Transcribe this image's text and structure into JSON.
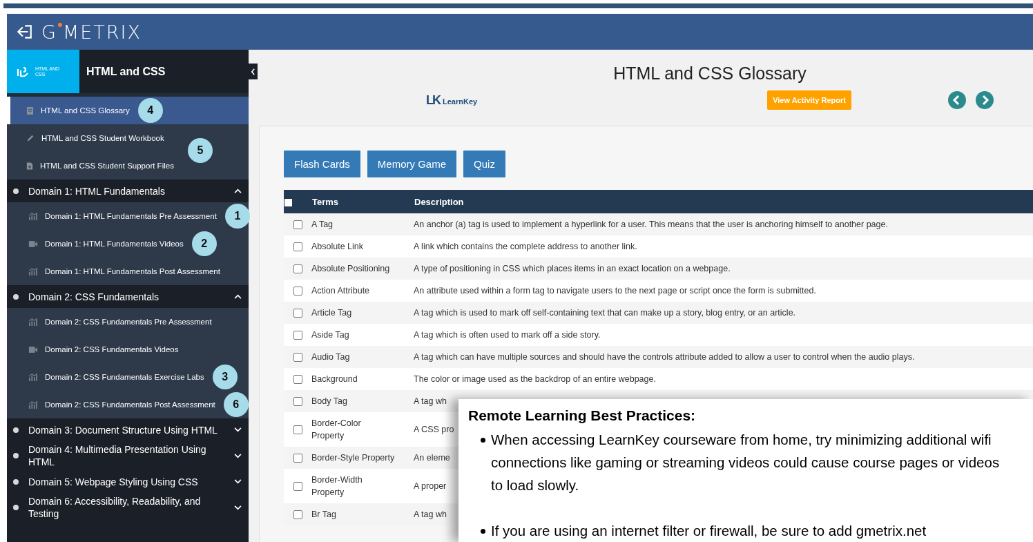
{
  "header": {
    "brand_parts": [
      "G",
      "METRIX"
    ]
  },
  "sidebar": {
    "course": {
      "badge_text": "HTML AND CSS",
      "title": "HTML and CSS"
    },
    "resources": [
      {
        "label": "HTML and CSS Glossary",
        "kind": "book",
        "selected": true,
        "marker": "4"
      },
      {
        "label": "HTML and CSS Student Workbook",
        "kind": "pencil",
        "selected": false,
        "marker": "5"
      },
      {
        "label": "HTML and CSS Student Support Files",
        "kind": "file",
        "selected": false
      }
    ],
    "domains": [
      {
        "label": "Domain 1: HTML Fundamentals",
        "expanded": true,
        "children": [
          {
            "label": "Domain 1: HTML Fundamentals Pre Assessment",
            "kind": "chart",
            "marker": "1"
          },
          {
            "label": "Domain 1: HTML Fundamentals Videos",
            "kind": "video",
            "marker": "2"
          },
          {
            "label": "Domain 1: HTML Fundamentals Post Assessment",
            "kind": "chart"
          }
        ]
      },
      {
        "label": "Domain 2: CSS Fundamentals",
        "expanded": true,
        "children": [
          {
            "label": "Domain 2: CSS Fundamentals Pre Assessment",
            "kind": "chart"
          },
          {
            "label": "Domain 2: CSS Fundamentals Videos",
            "kind": "video"
          },
          {
            "label": "Domain 2: CSS Fundamentals Exercise Labs",
            "kind": "chart",
            "marker": "3"
          },
          {
            "label": "Domain 2: CSS Fundamentals Post Assessment",
            "kind": "chart",
            "marker": "6"
          }
        ]
      },
      {
        "label": "Domain 3: Document Structure Using HTML",
        "expanded": false
      },
      {
        "label": "Domain 4: Multimedia Presentation Using HTML",
        "expanded": false
      },
      {
        "label": "Domain 5: Webpage Styling Using CSS",
        "expanded": false
      },
      {
        "label": "Domain 6: Accessibility, Readability, and Testing",
        "expanded": false
      }
    ]
  },
  "main": {
    "title": "HTML and CSS Glossary",
    "logo_mark": "LK",
    "logo_text": "LearnKey",
    "report_button": "View Activity Report",
    "activity_buttons": [
      "Flash Cards",
      "Memory Game",
      "Quiz"
    ],
    "table": {
      "columns": [
        "Terms",
        "Description"
      ],
      "select_all_checked": false,
      "rows": [
        {
          "term": "A Tag",
          "description": "An anchor (a) tag is used to implement a hyperlink for a user. This means that the user is anchoring himself to another page.",
          "checked": false
        },
        {
          "term": "Absolute Link",
          "description": "A link which contains the complete address to another link.",
          "checked": false
        },
        {
          "term": "Absolute Positioning",
          "description": "A type of positioning in CSS which places items in an exact location on a webpage.",
          "checked": false
        },
        {
          "term": "Action Attribute",
          "description": "An attribute used within a form tag to navigate users to the next page or script once the form is submitted.",
          "checked": false
        },
        {
          "term": "Article Tag",
          "description": "A tag which is used to mark off self-containing text that can make up a story, blog entry, or an article.",
          "checked": false
        },
        {
          "term": "Aside Tag",
          "description": "A tag which is often used to mark off a side story.",
          "checked": false
        },
        {
          "term": "Audio Tag",
          "description": "A tag which can have multiple sources and should have the controls attribute added to allow a user to control when the audio plays.",
          "checked": false
        },
        {
          "term": "Background",
          "description": "The color or image used as the backdrop of an entire webpage.",
          "checked": false
        },
        {
          "term": "Body Tag",
          "description": "A tag wh",
          "checked": false
        },
        {
          "term": "Border-Color Property",
          "description": "A CSS pro",
          "checked": false
        },
        {
          "term": "Border-Style Property",
          "description": "An eleme",
          "checked": false
        },
        {
          "term": "Border-Width Property",
          "description": "A proper",
          "checked": false
        },
        {
          "term": "Br Tag",
          "description": "A tag wh",
          "checked": false
        }
      ]
    }
  },
  "callout": {
    "title": "Remote Learning Best Practices:",
    "bullets": [
      "When accessing LearnKey courseware from home, try minimizing additional wifi connections like gaming or streaming videos could cause course pages or videos to load slowly.",
      "If you are using an internet filter or firewall, be sure to add gmetrix.net"
    ]
  }
}
